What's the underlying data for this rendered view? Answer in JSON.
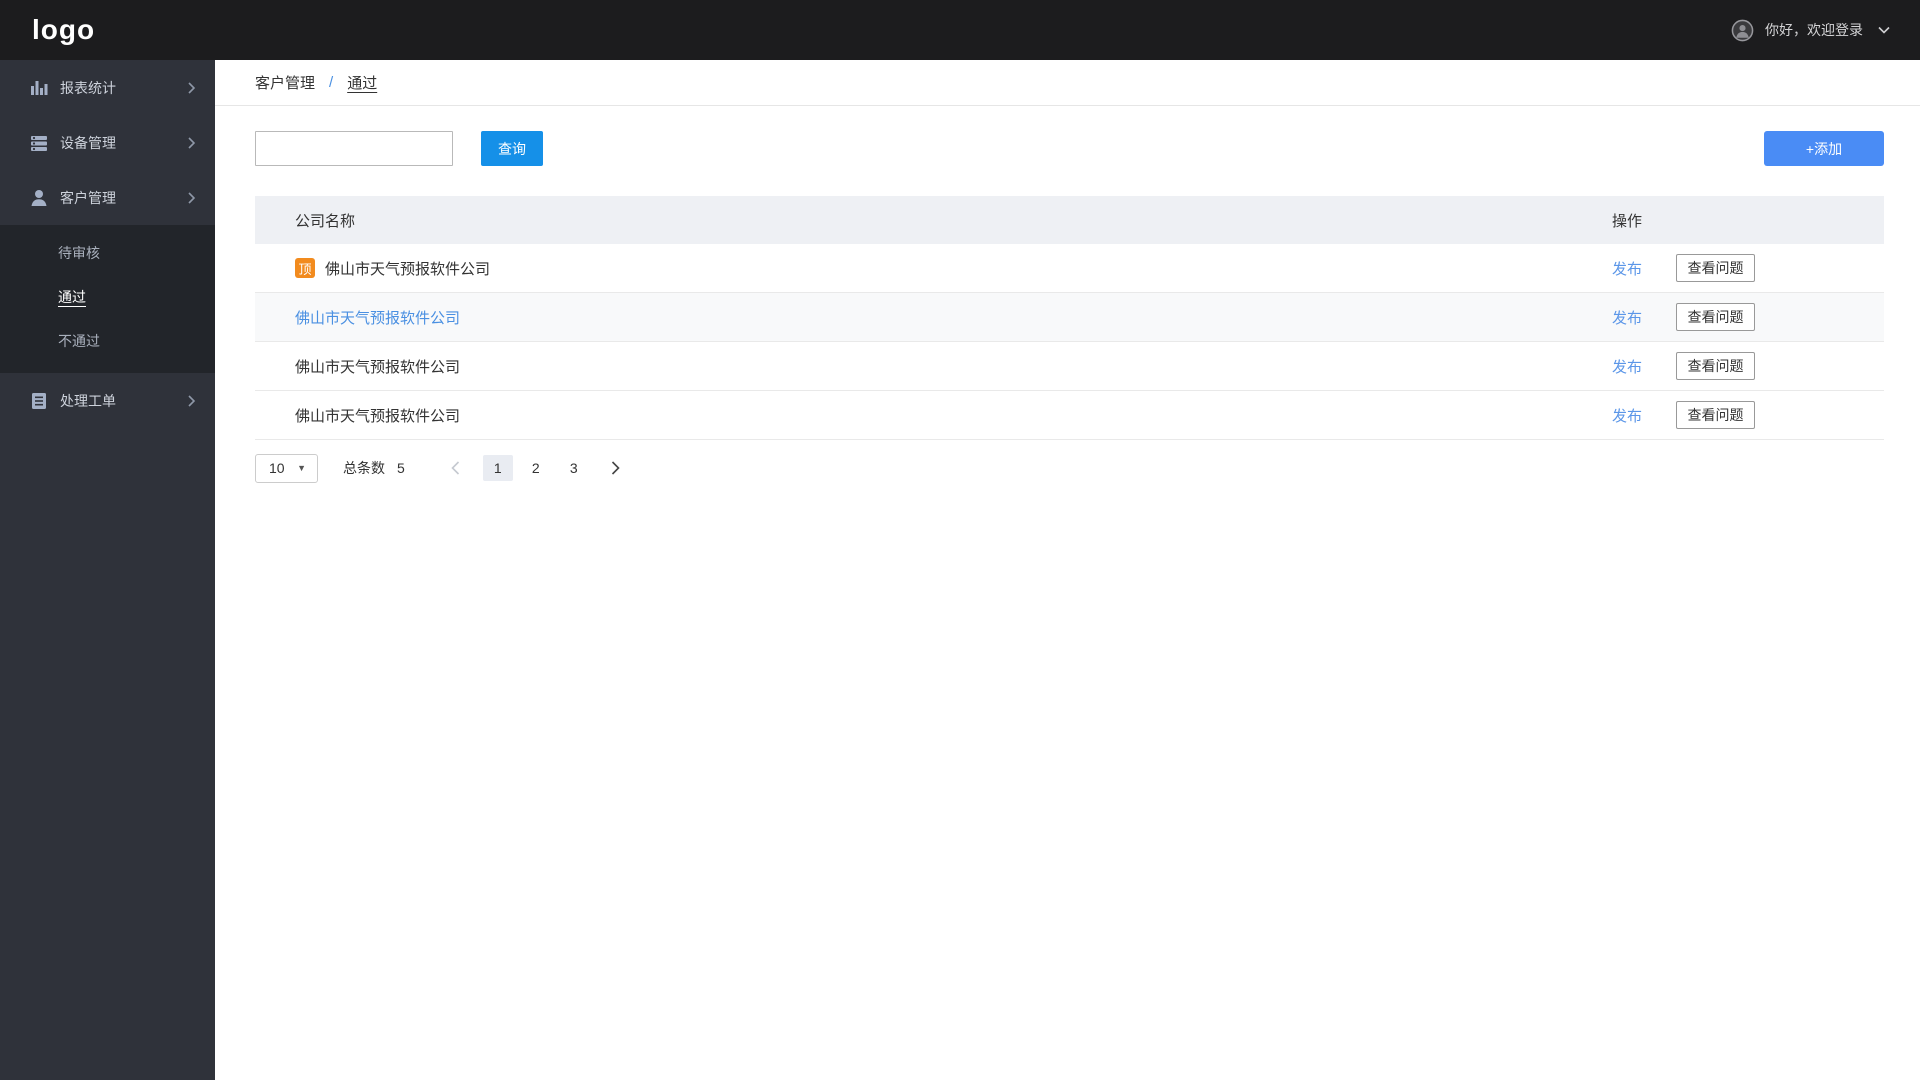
{
  "topbar": {
    "logo": "logo",
    "greeting": "你好，欢迎登录"
  },
  "sidebar": {
    "items": [
      {
        "label": "报表统计",
        "icon": "bar-chart-icon"
      },
      {
        "label": "设备管理",
        "icon": "server-icon"
      },
      {
        "label": "客户管理",
        "icon": "user-icon"
      },
      {
        "label": "处理工单",
        "icon": "document-icon"
      }
    ],
    "submenu": [
      {
        "label": "待审核",
        "active": false
      },
      {
        "label": "通过",
        "active": true
      },
      {
        "label": "不通过",
        "active": false
      }
    ]
  },
  "breadcrumb": {
    "parent": "客户管理",
    "separator": "/",
    "current": "通过"
  },
  "toolbar": {
    "search_value": "",
    "query_label": "查询",
    "add_label": "+添加"
  },
  "table": {
    "columns": {
      "name": "公司名称",
      "ops": "操作"
    },
    "rows": [
      {
        "badge": "顶",
        "company": "佛山市天气预报软件公司",
        "publish": "发布",
        "view": "查看问题"
      },
      {
        "company": "佛山市天气预报软件公司",
        "publish": "发布",
        "view": "查看问题"
      },
      {
        "company": "佛山市天气预报软件公司",
        "publish": "发布",
        "view": "查看问题"
      },
      {
        "company": "佛山市天气预报软件公司",
        "publish": "发布",
        "view": "查看问题"
      }
    ]
  },
  "pagination": {
    "page_size": "10",
    "total_label": "总条数",
    "total": "5",
    "pages": [
      "1",
      "2",
      "3"
    ],
    "current_page": "1"
  },
  "colors": {
    "query_button": "#1590e8",
    "add_button": "#4a8cf5",
    "link_blue": "#4a90e2",
    "badge_orange": "#f28b1e",
    "topbar_bg": "#1c1c1e",
    "sidebar_bg": "#2f323a",
    "submenu_bg": "#22252a",
    "header_bg": "#eef0f4"
  }
}
